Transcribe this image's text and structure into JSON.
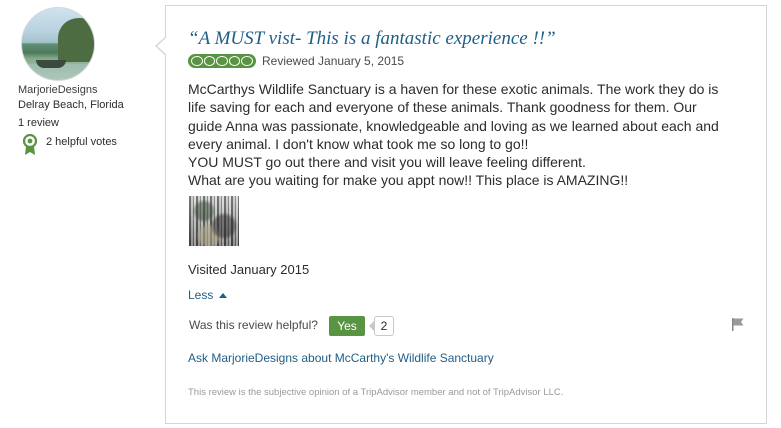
{
  "member": {
    "name": "MarjorieDesigns",
    "location": "Delray Beach, Florida",
    "reviews": "1 review",
    "helpful_votes": "2 helpful votes",
    "avatar_icon": "avatar-photo",
    "badge_icon": "helpful-votes-badge-icon"
  },
  "review": {
    "title": "“A MUST vist- This is a fantastic experience !!”",
    "rating": 5,
    "rating_max": 5,
    "reviewed_date": "Reviewed January 5, 2015",
    "body_lines": [
      "McCarthys Wildlife Sanctuary is a haven for these exotic animals. The work they do is",
      "life saving for each and everyone of these animals. Thank goodness for them. Our",
      "guide Anna was passionate, knowledgeable and loving as we learned about each and",
      "every animal. I don't know what took me so long to go!!",
      "YOU MUST go out there and visit you will leave feeling different.",
      "What are you waiting for make you appt now!! This place is AMAZING!!"
    ],
    "visited": "Visited January 2015",
    "less_label": "Less",
    "helpful_question": "Was this review helpful?",
    "yes_label": "Yes",
    "helpful_count": "2",
    "ask_link": "Ask MarjorieDesigns about McCarthy's Wildlife Sanctuary",
    "disclaimer": "This review is the subjective opinion of a TripAdvisor member and not of TripAdvisor LLC."
  },
  "colors": {
    "link": "#1f5e86",
    "rating_green": "#589442",
    "border": "#d5d5d5"
  }
}
